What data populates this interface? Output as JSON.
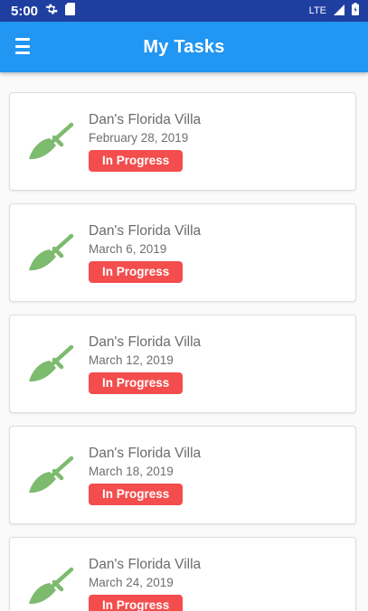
{
  "status_bar": {
    "time": "5:00",
    "network": "LTE",
    "icons": [
      "gear-icon",
      "sd-card-icon",
      "signal-icon",
      "battery-icon"
    ]
  },
  "app_bar": {
    "title": "My Tasks",
    "menu_icon": "hamburger-menu-icon",
    "color": "#2196f3"
  },
  "tasks": [
    {
      "name": "Dan's Florida Villa",
      "date": "February 28, 2019",
      "status": "In Progress",
      "icon": "broom-icon"
    },
    {
      "name": "Dan's Florida Villa",
      "date": "March 6, 2019",
      "status": "In Progress",
      "icon": "broom-icon"
    },
    {
      "name": "Dan's Florida Villa",
      "date": "March 12, 2019",
      "status": "In Progress",
      "icon": "broom-icon"
    },
    {
      "name": "Dan's Florida Villa",
      "date": "March 18, 2019",
      "status": "In Progress",
      "icon": "broom-icon"
    },
    {
      "name": "Dan's Florida Villa",
      "date": "March 24, 2019",
      "status": "In Progress",
      "icon": "broom-icon"
    }
  ],
  "colors": {
    "accent": "#2196f3",
    "status_in_progress": "#f44d4d",
    "broom": "#7dbb6e"
  }
}
